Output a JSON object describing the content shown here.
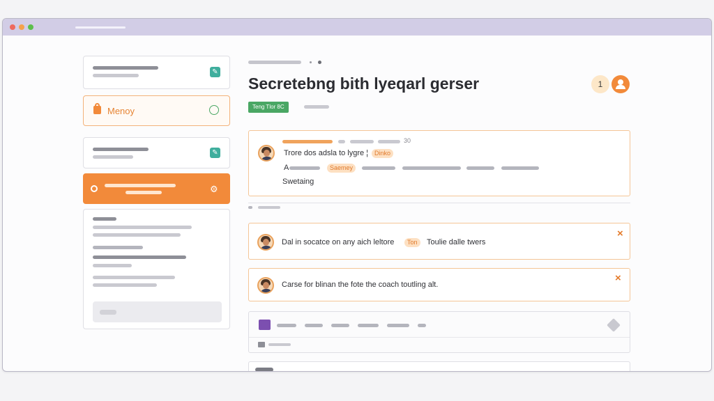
{
  "colors": {
    "accent": "#f28a3a",
    "success": "#4aa764",
    "teal": "#3fae9d",
    "window_bar": "#d2cde6"
  },
  "traffic_lights": [
    "#ee6a5f",
    "#f5a24b",
    "#5cbf4c"
  ],
  "sidebar": {
    "items": [
      {
        "icon": "teal-document-icon",
        "glyph": "✎"
      },
      {
        "label": "Menoy",
        "icon": "orange-lock-icon",
        "trailing_icon": "chat-bubble-icon"
      },
      {
        "icon": "teal-edit-icon",
        "glyph": "✎"
      },
      {
        "icon": "gear-icon",
        "glyph": "⚙"
      },
      {}
    ]
  },
  "header": {
    "title": "Secretebng bith lyeqarl gerser",
    "badge": "Teng Tlor 8C",
    "counter": "1"
  },
  "messages": [
    {
      "meta_count": "30",
      "line1": "Trore dos adsla to lygre ¦",
      "line1_tag": "Dinko",
      "line2_prefix": "A",
      "line2_tag": "Saemey",
      "line3": "Swetaing"
    },
    {
      "text": "Dal in socatce on any aich leltore",
      "tag": "Ton",
      "text2": "Toulie dalle twers",
      "close": "×"
    },
    {
      "text": "Carse for blinan the fote the coach toutling alt.",
      "close": "×"
    }
  ]
}
